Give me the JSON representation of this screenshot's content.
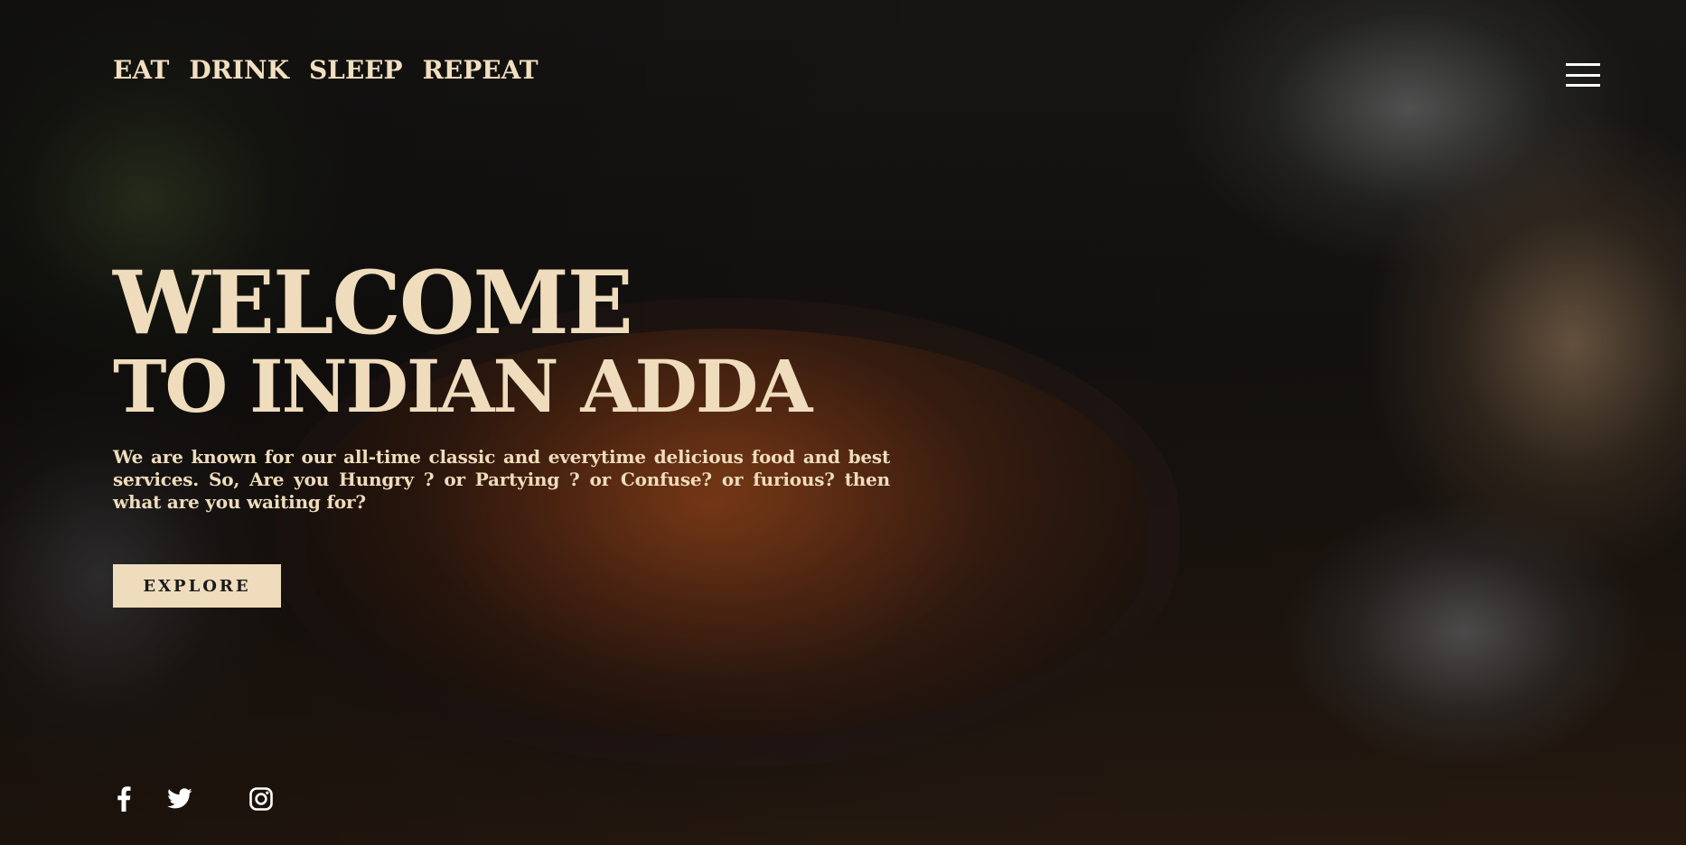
{
  "nav": {
    "items": [
      "EAT",
      "DRINK",
      "SLEEP",
      "REPEAT"
    ],
    "menu_icon": "hamburger-menu-icon"
  },
  "hero": {
    "title_line1": "WELCOME",
    "title_line2": "TO INDIAN ADDA",
    "description": "We are known for our all-time classic and everytime delicious food and best services. So, Are you Hungry ? or Partying ? or Confuse? or furious? then what are you waiting for?",
    "button_label": "EXPLORE"
  },
  "social": {
    "icons": [
      "facebook-icon",
      "twitter-icon",
      "instagram-icon"
    ]
  },
  "colors": {
    "accent": "#efdcbc",
    "icon": "#ffffff",
    "button_text": "#1a1a1a"
  }
}
